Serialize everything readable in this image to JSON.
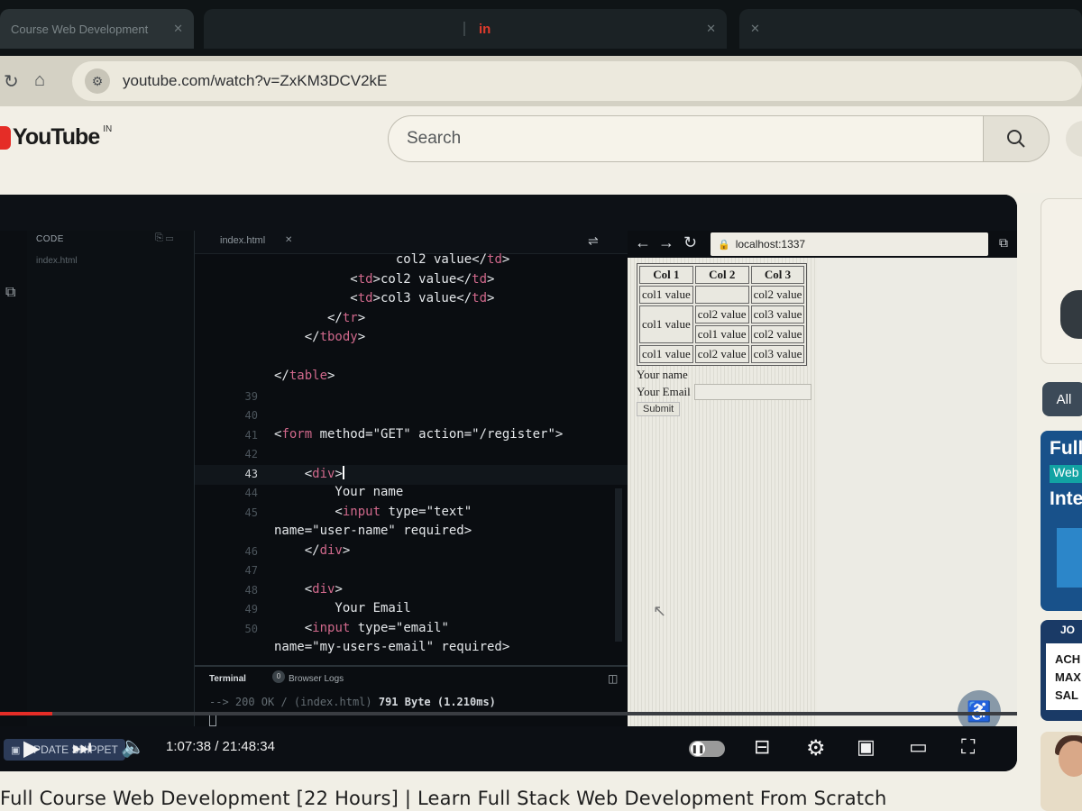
{
  "browser": {
    "tabs": [
      {
        "label": "Course Web Development",
        "close": "✕"
      },
      {
        "label": "",
        "badge": "in",
        "close": "✕"
      },
      {
        "label": "",
        "close": "✕"
      }
    ],
    "address": "youtube.com/watch?v=ZxKM3DCV2kE"
  },
  "youtube": {
    "logo": "YouTube",
    "country": "IN",
    "search_placeholder": "Search"
  },
  "ide": {
    "explorer_header": "CODE",
    "explorer_file": "index.html",
    "editor_tab": "index.html",
    "code_lines": [
      {
        "n": "",
        "text": "                col2 value</td>"
      },
      {
        "n": "",
        "text": "          <td>col2 value</td>"
      },
      {
        "n": "",
        "text": "          <td>col3 value</td>"
      },
      {
        "n": "",
        "text": "       </tr>"
      },
      {
        "n": "",
        "text": "    </tbody>"
      },
      {
        "n": "",
        "text": ""
      },
      {
        "n": "",
        "text": "</table>"
      },
      {
        "n": "39",
        "text": ""
      },
      {
        "n": "40",
        "text": ""
      },
      {
        "n": "41",
        "text": "<form method=\"GET\" action=\"/register\">"
      },
      {
        "n": "42",
        "text": ""
      },
      {
        "n": "43",
        "text": "    <div>"
      },
      {
        "n": "44",
        "text": "        Your name"
      },
      {
        "n": "45",
        "text": "        <input type=\"text\""
      },
      {
        "n": "",
        "text": "name=\"user-name\" required>"
      },
      {
        "n": "46",
        "text": "    </div>"
      },
      {
        "n": "47",
        "text": ""
      },
      {
        "n": "48",
        "text": "    <div>"
      },
      {
        "n": "49",
        "text": "        Your Email"
      },
      {
        "n": "50",
        "text": "    <input type=\"email\""
      },
      {
        "n": "",
        "text": "name=\"my-users-email\" required>"
      }
    ],
    "terminal_tab": "Terminal",
    "browser_logs_tab": "Browser Logs",
    "terminal_line_prefix": "--> 200 OK / (index.html) ",
    "terminal_line_size": "791 Byte (1.210ms)"
  },
  "preview": {
    "url": "localhost:1337",
    "table": {
      "headers": [
        "Col 1",
        "Col 2",
        "Col 3"
      ],
      "rows": [
        [
          "col1 value",
          "",
          "col2 value"
        ],
        [
          "col1 value",
          "col2 value",
          "col3 value"
        ],
        [
          "",
          "col1 value",
          "col2 value"
        ],
        [
          "col1 value",
          "col2 value",
          "col3 value"
        ]
      ]
    },
    "form": {
      "name_label": "Your name",
      "email_label": "Your Email",
      "submit_label": "Submit"
    }
  },
  "player": {
    "snippet_button": "UPDATE SNIPPET",
    "time": "1:07:38 / 21:48:34",
    "progress_fraction": 0.0516
  },
  "rail": {
    "chip": "All",
    "thumb1_line1": "Full",
    "thumb1_line2": "Web",
    "thumb1_line3": "Inte",
    "thumb2_line1": "JO",
    "thumb2_line2": "ACH",
    "thumb2_line3": "MAX",
    "thumb2_line4": "SAL"
  },
  "video_title": "Full Course Web Development [22 Hours] | Learn Full Stack Web Development From Scratch"
}
